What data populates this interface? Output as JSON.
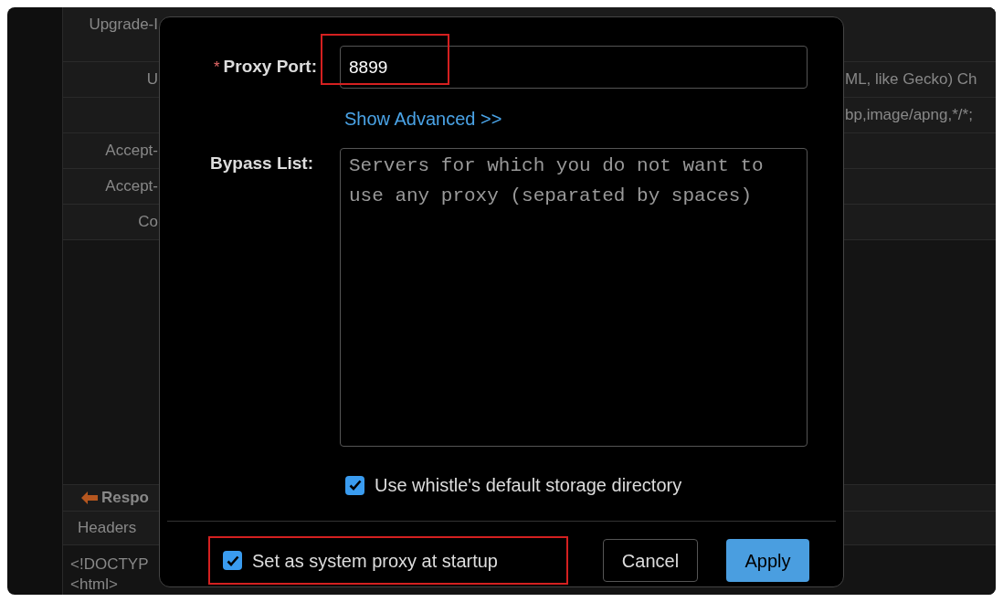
{
  "background_table": {
    "rows": [
      {
        "name": "Upgrade-I"
      },
      {
        "name": "U",
        "value": "ML, like Gecko) Ch"
      },
      {
        "value": "bp,image/apng,*/*;"
      },
      {
        "name": "Accept-"
      },
      {
        "name": "Accept-"
      },
      {
        "name": "Co"
      }
    ],
    "response_label": "Respo",
    "headers_tab": "Headers",
    "body_lines": [
      "<!DOCTYP",
      "<html>"
    ]
  },
  "dialog": {
    "port_label": "Proxy Port:",
    "required_mark": "*",
    "port_value": "8899",
    "port_highlighted": true,
    "advanced_link": "Show Advanced >>",
    "bypass_label": "Bypass List:",
    "bypass_placeholder": "Servers for which you do not want to use any proxy (separated by spaces)",
    "storage_option": {
      "label": "Use whistle's default storage directory",
      "checked": true
    },
    "startup_option": {
      "label": "Set as system proxy at startup",
      "checked": true,
      "highlighted": true
    },
    "buttons": [
      {
        "label": "Cancel",
        "kind": "secondary"
      },
      {
        "label": "Apply",
        "kind": "primary"
      }
    ]
  }
}
